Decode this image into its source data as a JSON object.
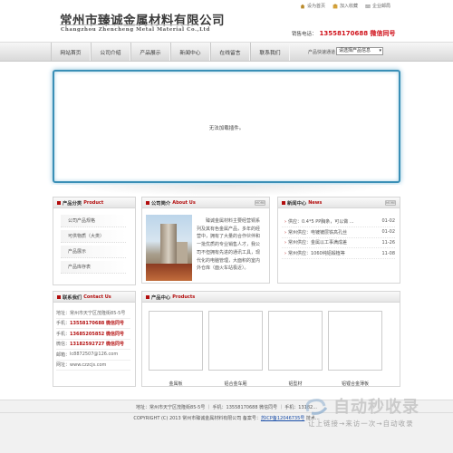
{
  "header": {
    "company_name": "常州市臻诚金属材料有限公司",
    "company_name_en": "Changzhou Zhencheng Metal Material Co.,Ltd",
    "top_links": [
      "设为首页",
      "加入收藏",
      "企业邮局"
    ],
    "hotline_label": "销售电话：",
    "hotline_number": "13558170688 微信同号"
  },
  "nav": {
    "items": [
      "网站首页",
      "公司介绍",
      "产品展示",
      "新闻中心",
      "在线留言",
      "联系我们"
    ],
    "search_label": "产品快速通道",
    "select_value": "请选择产品信息"
  },
  "banner": {
    "message": "无法加载插件。"
  },
  "product_category": {
    "title_cn": "产品分类",
    "title_en": "Product",
    "items": [
      "公司产品规格",
      "可供物质（大类）",
      "产品展示",
      "产品库存表"
    ]
  },
  "contact": {
    "title_cn": "联系我们",
    "title_en": "Contact Us",
    "rows": [
      {
        "label": "地址：",
        "value": "常州市天宁区茂隆街85-5号"
      },
      {
        "label": "手机：",
        "value": "13558170688 微信同号"
      },
      {
        "label": "手机：",
        "value": "13685205852 微信同号"
      },
      {
        "label": "微信：",
        "value": "13182592727 微信同号"
      },
      {
        "label": "邮箱：",
        "value": "lc8872507@126.com"
      },
      {
        "label": "网址：",
        "value": "www.czzcjs.com"
      }
    ]
  },
  "about": {
    "title_cn": "公司简介",
    "title_en": "About Us",
    "more": "MORE",
    "text": "臻诚金属材料主要经营铜系列及其有色金属产品，多年的经营中，拥有了大量的合作伙伴和一批优质的专业销售人才，我公司不但拥有先进的通讯工具，现代化的电脑管理，大面积的室内外仓库（面火车站极近）。"
  },
  "news": {
    "title_cn": "新闻中心",
    "title_en": "News",
    "more": "MORE",
    "items": [
      {
        "title": "供应：0.4*5 PP胸条，可以做 ...",
        "date": "01-02"
      },
      {
        "title": "常州供应：电镀镀层铁高孔丝",
        "date": "01-02"
      },
      {
        "title": "常州供应：金属以工事满成差",
        "date": "11-26"
      },
      {
        "title": "常州供应：1060纯铝锻植等",
        "date": "11-08"
      }
    ]
  },
  "products": {
    "title_cn": "产品中心",
    "title_en": "Products",
    "items": [
      "金属板",
      "铝合金车厢",
      "铝型材",
      "铝锂合金薄板"
    ]
  },
  "footer": {
    "line1": "地址：常州市天宁区茂隆街85-5号 ｜ 手机：13558170688 微信同号 ｜ 手机：13182...",
    "line2_prefix": "COPYRIGHT (C) 2013 常州市臻诚金属材料有限公司 备案号：",
    "icp": "苏ICP备12046735号",
    "line2_suffix": " 技术..."
  },
  "watermark": {
    "title": "自动秒收录",
    "subtitle": "让上链接→来访一次→自动收录"
  }
}
